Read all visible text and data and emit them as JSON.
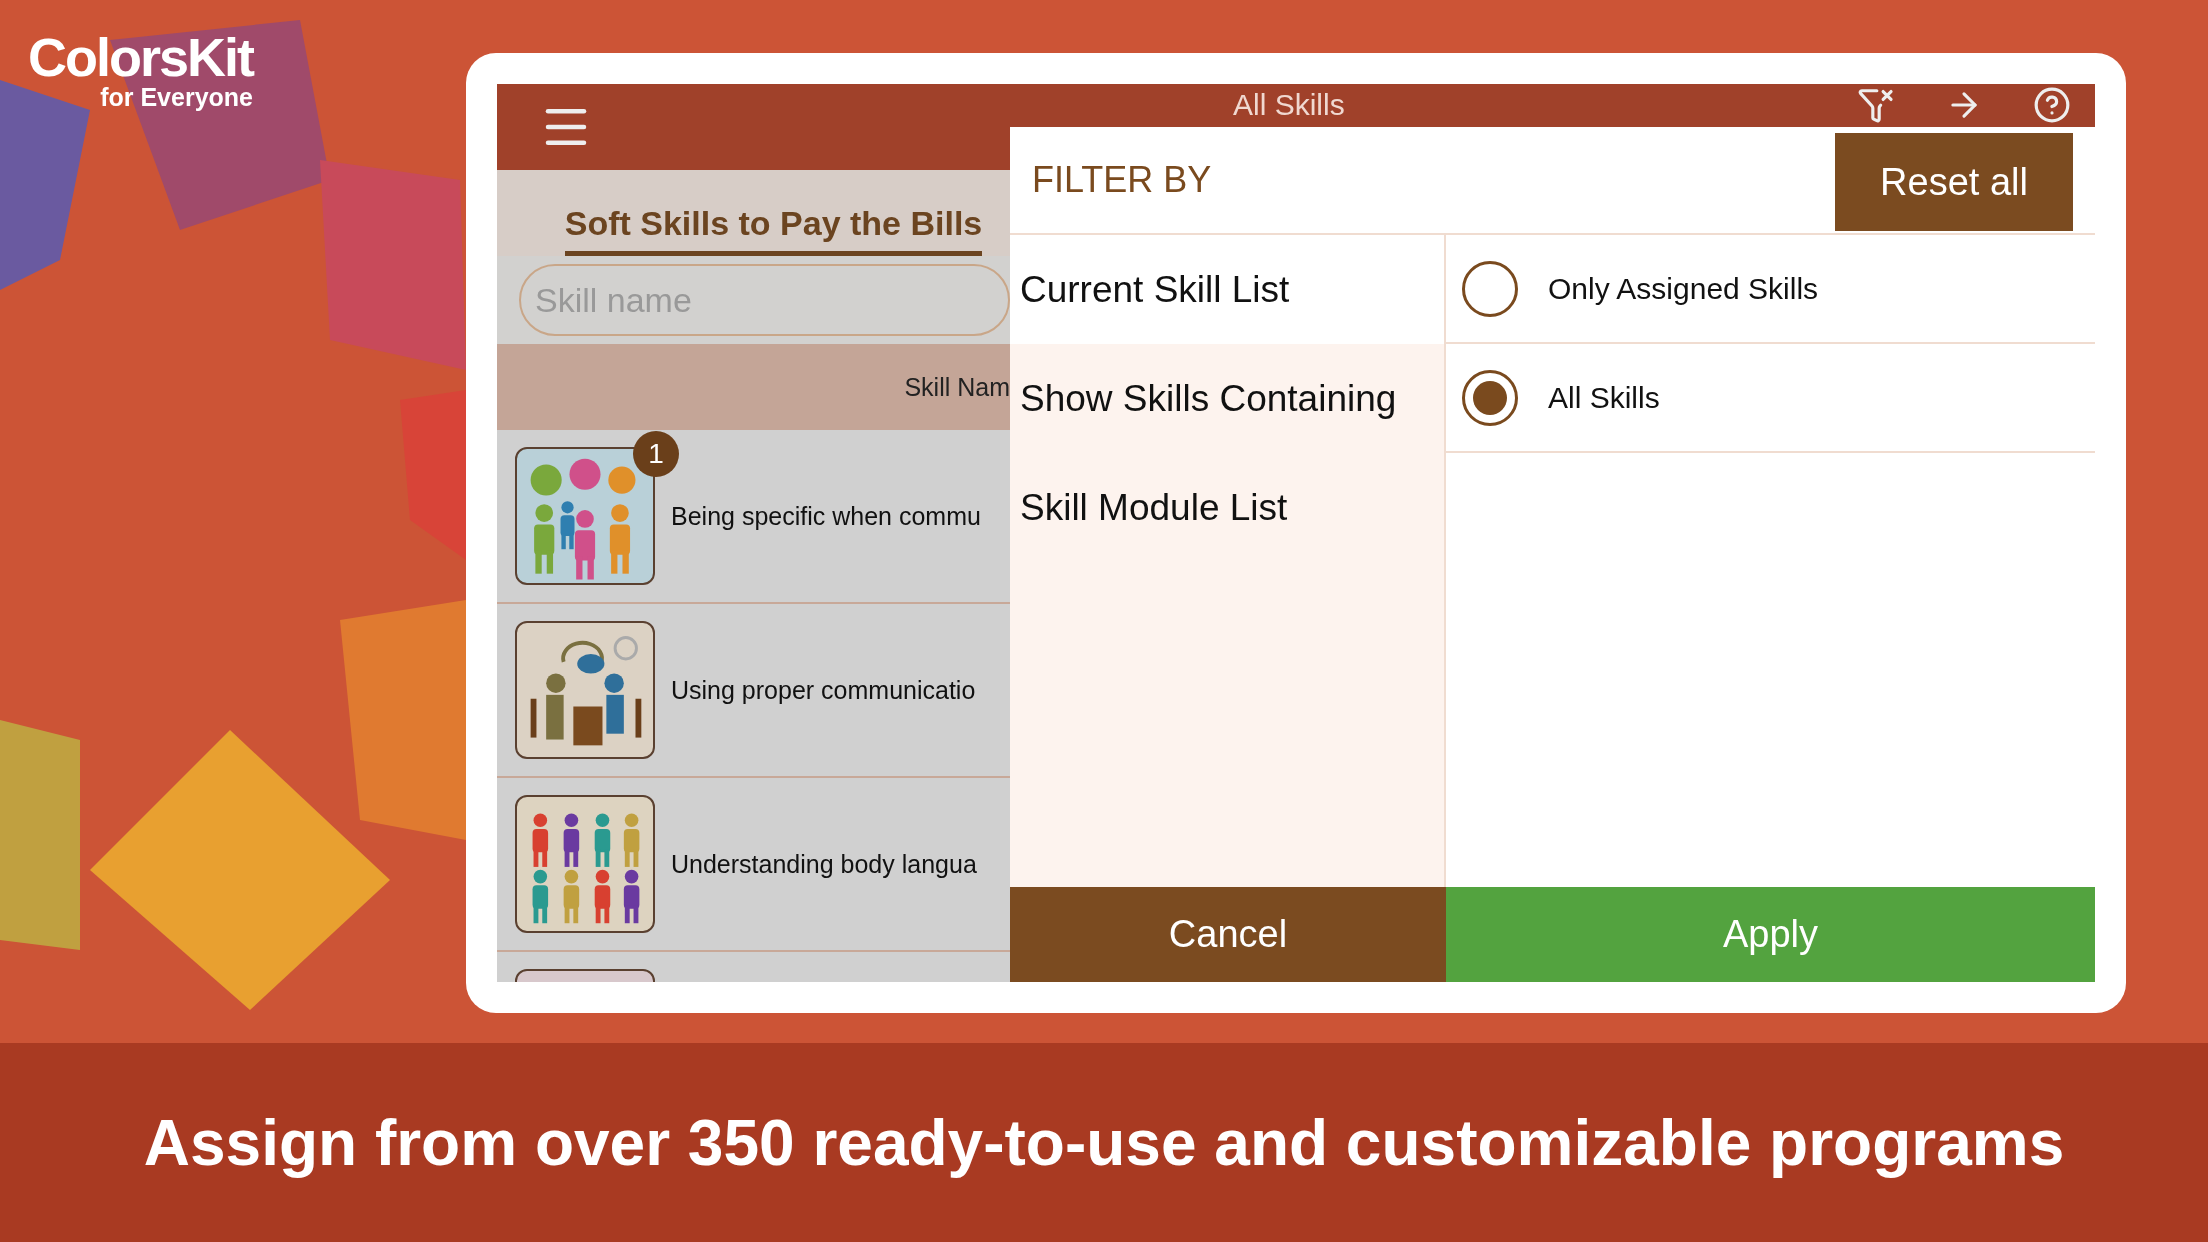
{
  "brand": {
    "name": "ColorsKit",
    "tagline": "for Everyone"
  },
  "app": {
    "title": "All Skills",
    "tab": {
      "label": "Soft Skills to Pay the Bills",
      "selected": true
    },
    "search": {
      "placeholder": "Skill name"
    },
    "column": "Skill Nam",
    "rows": [
      {
        "title": "Being specific when commu",
        "badge": "1"
      },
      {
        "title": "Using proper communicatio"
      },
      {
        "title": "Understanding body langua"
      }
    ]
  },
  "filter": {
    "title": "FILTER BY",
    "reset": "Reset all",
    "categories": [
      {
        "label": "Current Skill List",
        "selected": true
      },
      {
        "label": "Show Skills Containing",
        "selected": false
      },
      {
        "label": "Skill Module List",
        "selected": false
      }
    ],
    "options": [
      {
        "label": "Only Assigned Skills",
        "selected": false
      },
      {
        "label": "All Skills",
        "selected": true
      }
    ],
    "cancel": "Cancel",
    "apply": "Apply"
  },
  "caption": "Assign from over 350 ready-to-use and customizable programs"
}
